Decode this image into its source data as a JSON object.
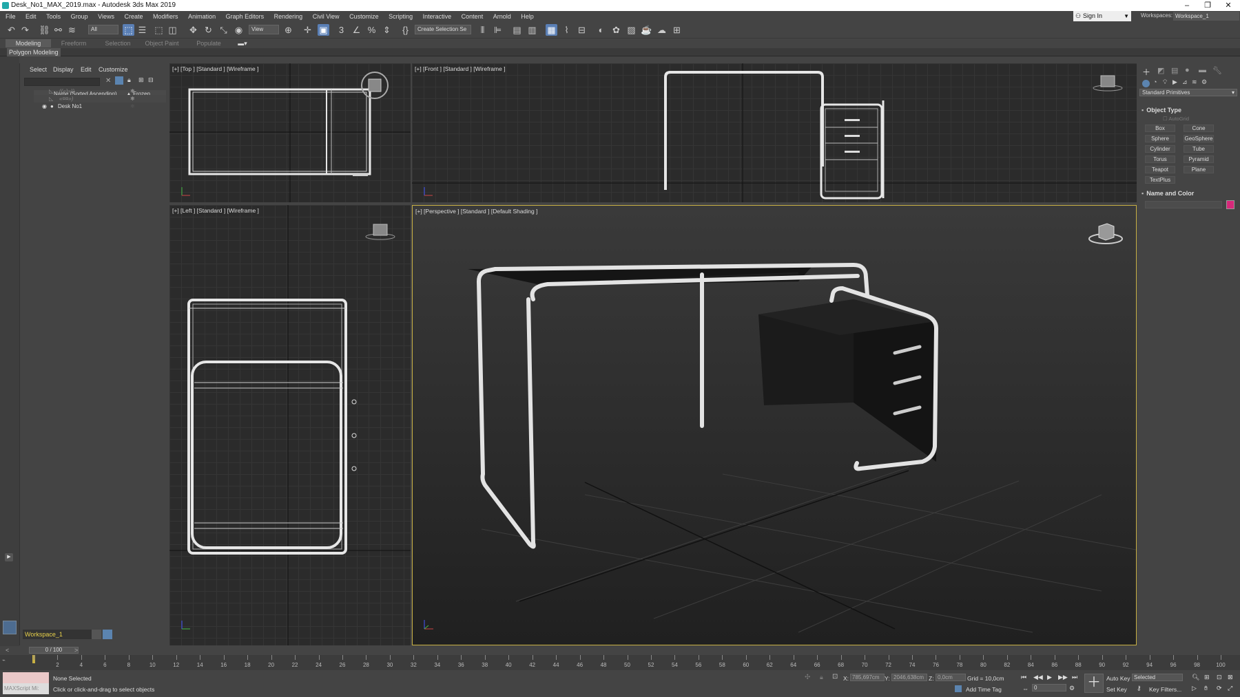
{
  "window": {
    "title": "Desk_No1_MAX_2019.max - Autodesk 3ds Max 2019"
  },
  "menu": [
    "File",
    "Edit",
    "Tools",
    "Group",
    "Views",
    "Create",
    "Modifiers",
    "Animation",
    "Graph Editors",
    "Rendering",
    "Civil View",
    "Customize",
    "Scripting",
    "Interactive",
    "Content",
    "Arnold",
    "Help"
  ],
  "account": {
    "signin": "Sign In",
    "workspaces_label": "Workspaces:",
    "workspace": "Workspace_1"
  },
  "toolbar": {
    "filter": "All",
    "refcoord": "View",
    "selset": "Create Selection Se"
  },
  "ribbon": {
    "tabs": [
      "Modeling",
      "Freeform",
      "Selection",
      "Object Paint",
      "Populate"
    ],
    "subtitle": "Polygon Modeling"
  },
  "explorer": {
    "tabs": [
      "Select",
      "Display",
      "Edit",
      "Customize"
    ],
    "column_name": "Name (Sorted Ascending)",
    "column_frozen": "▲ Frozen",
    "rows": [
      {
        "name": "((«)»))",
        "dim": true
      },
      {
        "name": "«¤¤»)",
        "dim": true
      },
      {
        "name": "Desk No1",
        "dim": false
      }
    ],
    "workspace": "Workspace_1"
  },
  "viewports": {
    "top": "[+] [Top ] [Standard ] [Wireframe ]",
    "front": "[+] [Front ] [Standard ] [Wireframe ]",
    "left": "[+] [Left ] [Standard ] [Wireframe ]",
    "persp": "[+] [Perspective ] [Standard ] [Default Shading ]"
  },
  "command_panel": {
    "dropdown": "Standard Primitives",
    "object_type": "Object Type",
    "autogrid": "AutoGrid",
    "buttons": [
      "Box",
      "Cone",
      "Sphere",
      "GeoSphere",
      "Cylinder",
      "Tube",
      "Torus",
      "Pyramid",
      "Teapot",
      "Plane",
      "TextPlus"
    ],
    "name_color": "Name and Color",
    "color": "#d6287a"
  },
  "timeline": {
    "slider": "0 / 100",
    "ticks": [
      "0",
      "2",
      "4",
      "6",
      "8",
      "10",
      "12",
      "14",
      "16",
      "18",
      "20",
      "22",
      "24",
      "26",
      "28",
      "30",
      "32",
      "34",
      "36",
      "38",
      "40",
      "42",
      "44",
      "46",
      "48",
      "50",
      "52",
      "54",
      "56",
      "58",
      "60",
      "62",
      "64",
      "66",
      "68",
      "70",
      "72",
      "74",
      "76",
      "78",
      "80",
      "82",
      "84",
      "86",
      "88",
      "90",
      "92",
      "94",
      "96",
      "98",
      "100"
    ]
  },
  "status": {
    "maxscript": "MAXScript Mi:",
    "selected": "None Selected",
    "prompt": "Click or click-and-drag to select objects",
    "x_label": "X:",
    "x_val": "785,697cm",
    "y_label": "Y:",
    "y_val": "2046,638cm",
    "z_label": "Z:",
    "z_val": "0,0cm",
    "grid": "Grid = 10,0cm",
    "add_time_tag": "Add Time Tag",
    "auto_key": "Auto Key",
    "set_key": "Set Key",
    "selected_dd": "Selected",
    "key_filters": "Key Filters...",
    "frame": "0"
  }
}
